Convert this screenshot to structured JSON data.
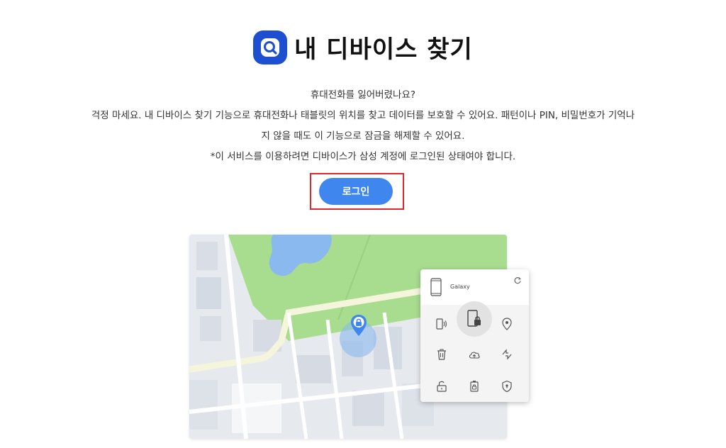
{
  "header": {
    "title": "내 디바이스 찾기",
    "app_icon": "magnifier-icon"
  },
  "description": {
    "line1": "휴대전화를 잃어버렸나요?",
    "line2": "걱정 마세요. 내 디바이스 찾기 기능으로 휴대전화나 태블릿의 위치를 찾고 데이터를 보호할 수 있어요. 패턴이나 PIN, 비밀번호가 기억나",
    "line3": "지 않을 때도 이 기능으로 잠금을 해제할 수 있어요.",
    "line4": "*이 서비스를 이용하려면 디바이스가 삼성 계정에 로그인된 상태여야 합니다."
  },
  "login": {
    "label": "로그인"
  },
  "preview": {
    "device_name": "Galaxy",
    "functions": [
      "ring-icon",
      "lock-icon",
      "location-icon",
      "delete-icon",
      "backup-icon",
      "battery-icon",
      "unlock-icon",
      "guardian-icon",
      "shield-icon"
    ]
  },
  "colors": {
    "accent": "#3f87ee",
    "app_icon": "#1f4fd1",
    "highlight": "#e0282c",
    "park": "#a8dc8f",
    "water": "#8ab9f0",
    "road": "#f5f5dc"
  }
}
